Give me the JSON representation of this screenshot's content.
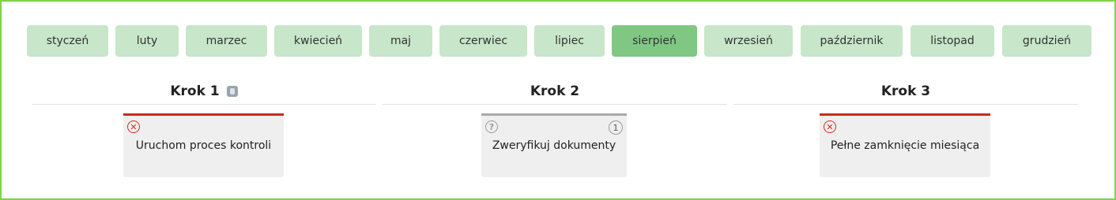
{
  "months": [
    {
      "label": "styczeń"
    },
    {
      "label": "luty"
    },
    {
      "label": "marzec"
    },
    {
      "label": "kwiecień"
    },
    {
      "label": "maj"
    },
    {
      "label": "czerwiec"
    },
    {
      "label": "lipiec"
    },
    {
      "label": "sierpień",
      "active": true
    },
    {
      "label": "wrzesień"
    },
    {
      "label": "październik"
    },
    {
      "label": "listopad"
    },
    {
      "label": "grudzień"
    }
  ],
  "steps": [
    {
      "title": "Krok 1",
      "has_info_icon": true,
      "card": {
        "status": "failed",
        "status_icon": "close-circle-icon",
        "label": "Uruchom proces kontroli"
      }
    },
    {
      "title": "Krok 2",
      "card": {
        "status": "pending",
        "status_icon": "question-circle-icon",
        "count": "1",
        "label": "Zweryfikuj dokumenty"
      }
    },
    {
      "title": "Krok 3",
      "card": {
        "status": "failed",
        "status_icon": "close-circle-icon",
        "label": "Pełne zamknięcie miesiąca"
      }
    }
  ],
  "colors": {
    "frame_border": "#7fd34a",
    "month_bg": "#c8e6c9",
    "month_active_bg": "#81c784",
    "failed": "#cc2a20",
    "pending": "#a9a9a9"
  }
}
